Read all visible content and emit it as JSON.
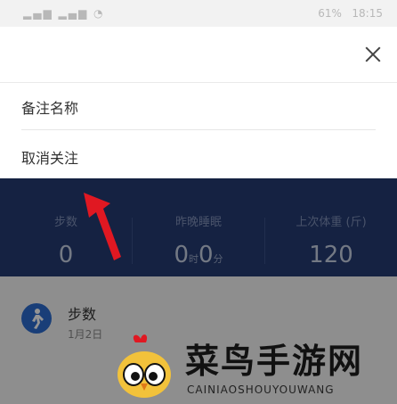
{
  "status_bar": {
    "left_icons": "signal-wifi-icons",
    "battery": "61%",
    "time": "18:15"
  },
  "sheet": {
    "items": [
      {
        "label": "备注名称"
      },
      {
        "label": "取消关注"
      }
    ]
  },
  "stats": [
    {
      "label": "步数",
      "value": "0"
    },
    {
      "label": "昨晚睡眠",
      "hours": "0",
      "hours_unit": "时",
      "minutes": "0",
      "minutes_unit": "分"
    },
    {
      "label": "上次体重 (斤)",
      "value": "120"
    }
  ],
  "card": {
    "title": "步数",
    "date": "1月2日"
  },
  "watermark": {
    "title": "菜鸟手游网",
    "subtitle": "CAINIAOSHOUYOUWANG"
  },
  "colors": {
    "header_blue": "#253b72",
    "annotation_red": "#e01822",
    "icon_blue": "#2c6ccf"
  }
}
